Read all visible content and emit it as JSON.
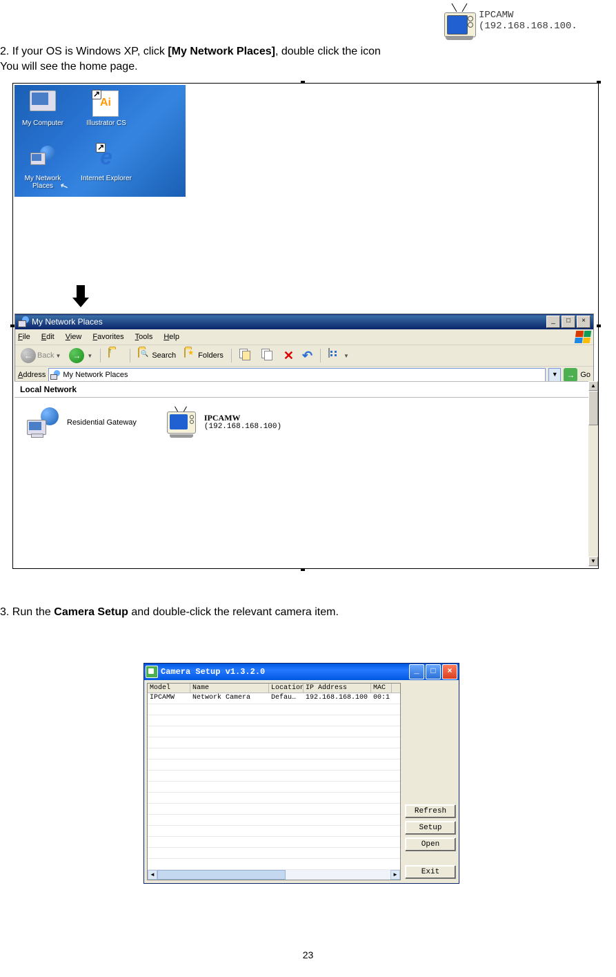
{
  "intro": {
    "part1": "2. If your OS is Windows XP, click ",
    "bold": "[My Network Places]",
    "part2": ", double click the icon",
    "line2": "You will see the home page."
  },
  "ipcamw_top": {
    "name": "IPCAMW",
    "ip": "(192.168.168.100."
  },
  "desktop": {
    "mycomputer": "My Computer",
    "illustrator": "Illustrator CS",
    "mynetwork": "My Network Places",
    "ie": "Internet Explorer"
  },
  "window": {
    "title": "My Network Places",
    "menus": {
      "file": "File",
      "edit": "Edit",
      "view": "View",
      "favorites": "Favorites",
      "tools": "Tools",
      "help": "Help"
    },
    "toolbar": {
      "back": "Back",
      "search": "Search",
      "folders": "Folders"
    },
    "address": {
      "label": "Address",
      "value": "My Network Places",
      "go": "Go"
    },
    "section": "Local Network",
    "items": {
      "gateway": "Residential Gateway",
      "ipcam_name": "IPCAMW",
      "ipcam_ip": "(192.168.168.100)"
    }
  },
  "step3": {
    "part1": "3. Run the ",
    "bold": "Camera Setup",
    "part2": " and double-click the relevant camera item."
  },
  "setup": {
    "title": "Camera Setup v1.3.2.0",
    "columns": {
      "model": "Model",
      "name": "Name",
      "location": "Location",
      "ip": "IP Address",
      "mac": "MAC"
    },
    "row": {
      "model": "IPCAMW",
      "name": "Network Camera",
      "location": "Defau…",
      "ip": "192.168.168.100",
      "mac": "00:1"
    },
    "buttons": {
      "refresh": "Refresh",
      "setup": "Setup",
      "open": "Open",
      "exit": "Exit"
    }
  },
  "page_number": "23"
}
